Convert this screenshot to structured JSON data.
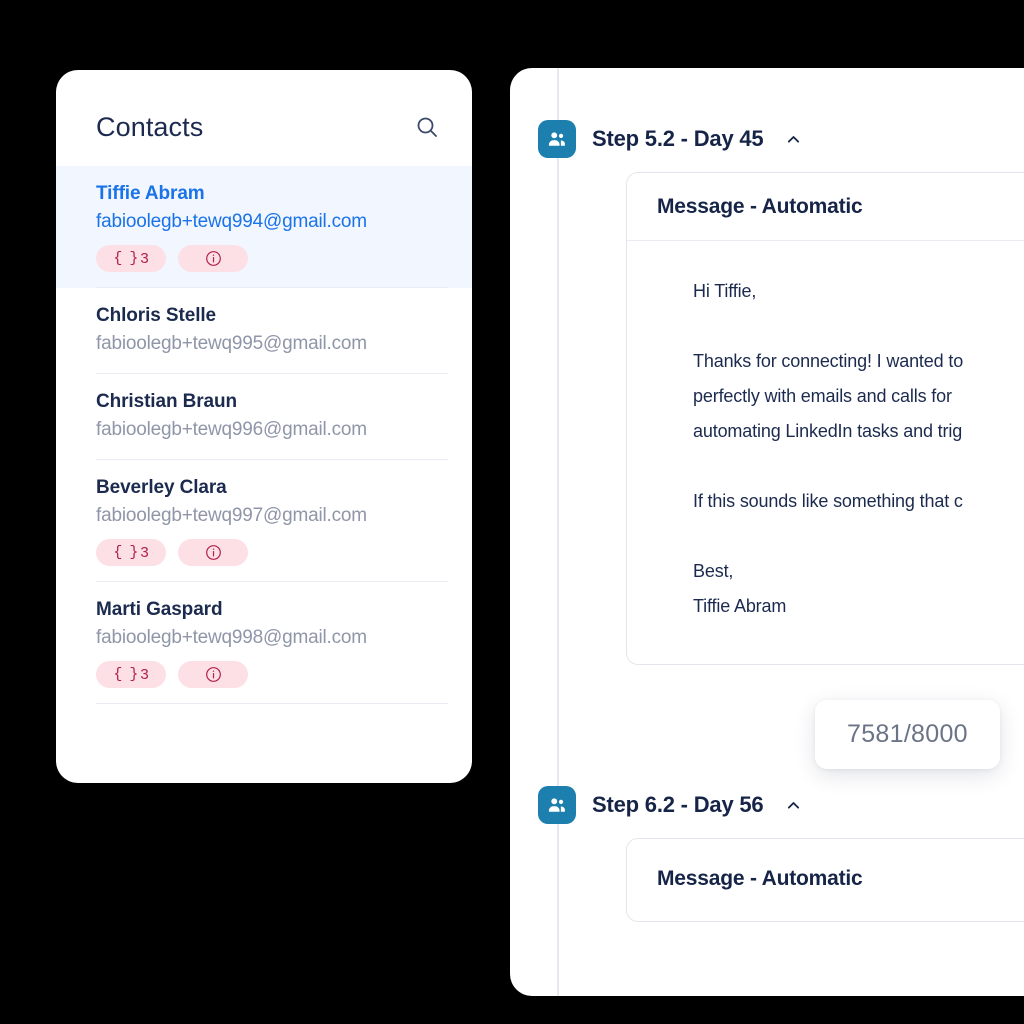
{
  "contacts_panel": {
    "title": "Contacts",
    "search_icon": "search-icon",
    "items": [
      {
        "name": "Tiffie Abram",
        "email": "fabioolegb+tewq994@gmail.com",
        "selected": true,
        "badges": {
          "variables_count": "3",
          "brace": "{ }",
          "info_icon": "info-circle-icon"
        }
      },
      {
        "name": "Chloris Stelle",
        "email": "fabioolegb+tewq995@gmail.com",
        "selected": false,
        "badges": null
      },
      {
        "name": "Christian Braun",
        "email": "fabioolegb+tewq996@gmail.com",
        "selected": false,
        "badges": null
      },
      {
        "name": "Beverley Clara",
        "email": "fabioolegb+tewq997@gmail.com",
        "selected": false,
        "badges": {
          "variables_count": "3",
          "brace": "{ }",
          "info_icon": "info-circle-icon"
        }
      },
      {
        "name": "Marti Gaspard",
        "email": "fabioolegb+tewq998@gmail.com",
        "selected": false,
        "badges": {
          "variables_count": "3",
          "brace": "{ }",
          "info_icon": "info-circle-icon"
        }
      }
    ]
  },
  "sequence_panel": {
    "steps": [
      {
        "title": "Step 5.2 - Day 45",
        "icon": "contacts-people-icon",
        "chevron": "chevron-up-icon",
        "card_title": "Message - Automatic",
        "body": "Hi Tiffie,\n\nThanks for connecting! I wanted to\nperfectly with emails and calls for\nautomating LinkedIn tasks and trig\n\nIf this sounds like something that c\n\nBest,\nTiffie Abram"
      },
      {
        "title": "Step 6.2 - Day 56",
        "icon": "contacts-people-icon",
        "chevron": "chevron-up-icon",
        "card_title": "Message - Automatic",
        "body": ""
      }
    ],
    "char_counter": "7581/8000"
  },
  "colors": {
    "accent_blue": "#1a73e8",
    "icon_teal": "#1c7fae",
    "badge_bg": "#fde0e6",
    "badge_fg": "#b0214a",
    "selected_row_bg": "#f2f6fe",
    "text_dark": "#162447",
    "text_muted": "#8e96a8",
    "background": "#000000"
  }
}
